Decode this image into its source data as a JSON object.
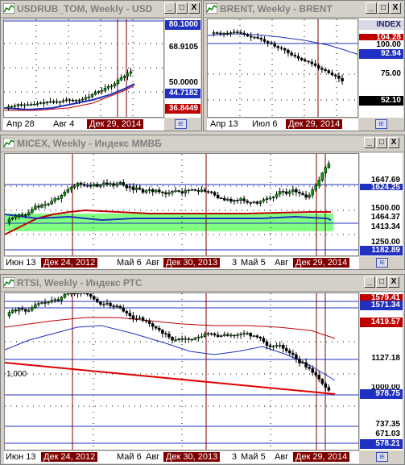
{
  "windows": {
    "usdrub": {
      "title": "USDRUB_TOM, Weekly - USD",
      "y_labels": [
        "80.1000",
        "68.9105",
        "50.0000",
        "44.7182",
        "36.8449"
      ],
      "x_labels": [
        "Апр 28",
        "Авг 4",
        "Дек 29, 2014"
      ],
      "corner_label": "IE"
    },
    "brent": {
      "title": "BRENT, Weekly - BRENT",
      "y_labels": [
        "INDEX",
        "104.28",
        "100.00",
        "92.94",
        "75.00",
        "52.10"
      ],
      "x_labels": [
        "Апр 13",
        "Июл 6",
        "Дек 29, 2014"
      ],
      "corner_label": "IE"
    },
    "micex": {
      "title": "MICEX, Weekly - Индекс ММВБ",
      "y_labels": [
        "1647.69",
        "1624.25",
        "1500.00",
        "1464.37",
        "1413.34",
        "1250.00",
        "1182.89"
      ],
      "x_labels": [
        "Июн 13",
        "Дек 24, 2012",
        "Май 6",
        "Авг",
        "Дек 30, 2013",
        "3",
        "Май 5",
        "Авг",
        "Дек 29, 2014"
      ],
      "corner_label": "IE"
    },
    "rtsi": {
      "title": "RTSI, Weekly - Индекс РТС",
      "y_labels": [
        "1579.41",
        "1571.34",
        "1419.57",
        "1127.18",
        "1000.00",
        "978.75",
        "737.35",
        "671.03",
        "578.21"
      ],
      "left_label": "1,000",
      "x_labels": [
        "Июн 13",
        "Дек 24, 2012",
        "Май 6",
        "Авг",
        "Дек 30, 2013",
        "3",
        "Май 5",
        "Авг",
        "Дек 29, 2014"
      ],
      "corner_label": "IE"
    }
  },
  "buttons": {
    "minimize": "_",
    "maximize": "□",
    "close": "X"
  },
  "colors": {
    "candle_up": "#00a000",
    "candle_down": "#000000",
    "ma_red": "#c00000",
    "ma_blue": "#2030c0",
    "marker": "#800000",
    "band": "#80ff80"
  }
}
